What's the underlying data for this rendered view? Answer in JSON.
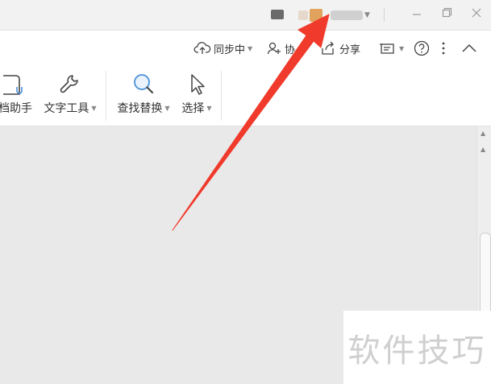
{
  "titlebar": {
    "icons": [
      "screen-record-icon",
      "avatar",
      "chevron-down-icon",
      "minimize-icon",
      "restore-icon",
      "close-icon"
    ]
  },
  "toolbar": {
    "sync_label": "同步中",
    "collab_label": "协",
    "share_label": "分享"
  },
  "ribbon": {
    "items": [
      {
        "label": "档助手"
      },
      {
        "label": "文字工具"
      },
      {
        "label": "查找替换"
      },
      {
        "label": "选择"
      }
    ]
  },
  "watermark": {
    "text": "软件技巧"
  },
  "colors": {
    "arrow": "#f03a2b",
    "icon_blue": "#4a90d9",
    "avatar": "#e0a25c"
  }
}
